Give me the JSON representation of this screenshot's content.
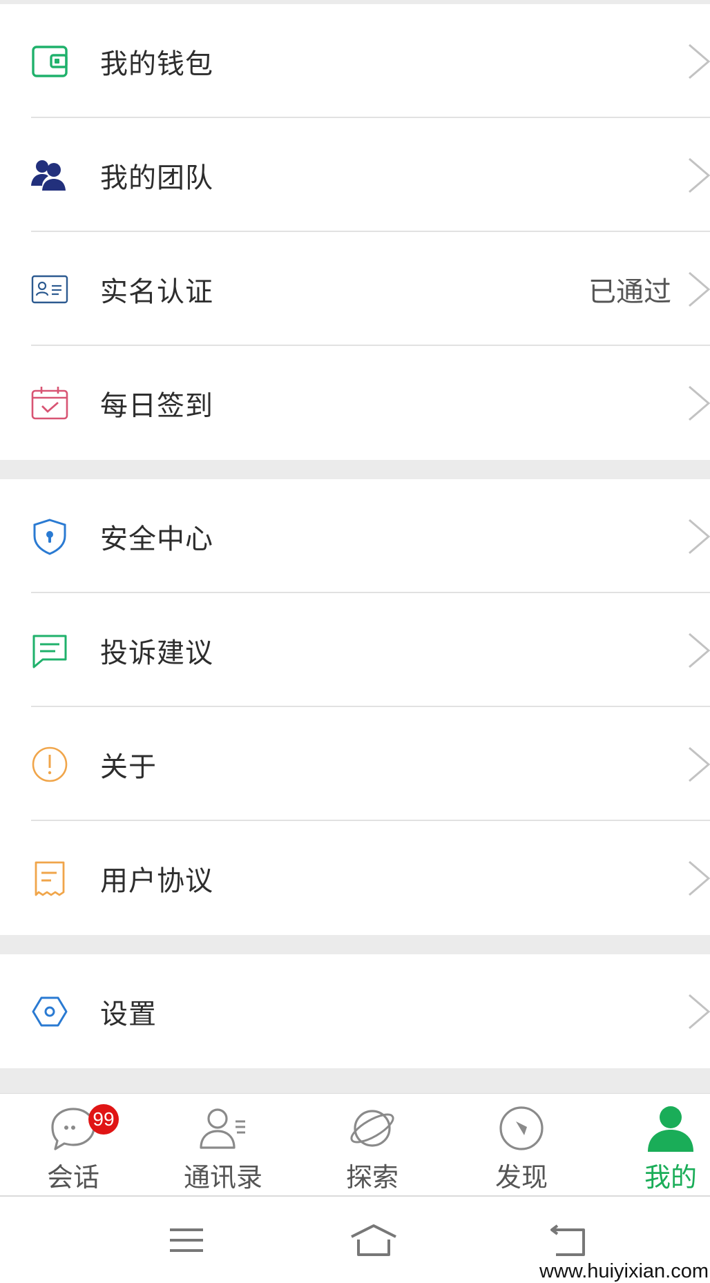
{
  "groups": [
    {
      "items": [
        {
          "id": "wallet",
          "label": "我的钱包",
          "value": "",
          "icon": "wallet-icon",
          "color": "#1fb16b"
        },
        {
          "id": "team",
          "label": "我的团队",
          "value": "",
          "icon": "team-icon",
          "color": "#22307c"
        },
        {
          "id": "realname",
          "label": "实名认证",
          "value": "已通过",
          "icon": "id-card-icon",
          "color": "#2c5a90"
        },
        {
          "id": "checkin",
          "label": "每日签到",
          "value": "",
          "icon": "calendar-check-icon",
          "color": "#d85473"
        }
      ]
    },
    {
      "items": [
        {
          "id": "security",
          "label": "安全中心",
          "value": "",
          "icon": "shield-icon",
          "color": "#2a7ad2"
        },
        {
          "id": "feedback",
          "label": "投诉建议",
          "value": "",
          "icon": "message-icon",
          "color": "#1fb16b"
        },
        {
          "id": "about",
          "label": "关于",
          "value": "",
          "icon": "info-icon",
          "color": "#f0a54a"
        },
        {
          "id": "agreement",
          "label": "用户协议",
          "value": "",
          "icon": "document-icon",
          "color": "#f0a54a"
        }
      ]
    },
    {
      "items": [
        {
          "id": "settings",
          "label": "设置",
          "value": "",
          "icon": "settings-icon",
          "color": "#2a7ad2"
        }
      ]
    }
  ],
  "tabs": [
    {
      "label": "会话",
      "icon": "chat-icon",
      "badge": "99"
    },
    {
      "label": "通讯录",
      "icon": "contacts-icon"
    },
    {
      "label": "探索",
      "icon": "planet-icon"
    },
    {
      "label": "发现",
      "icon": "compass-icon"
    },
    {
      "label": "我的",
      "icon": "person-icon",
      "active": true
    }
  ],
  "system_nav": [
    "menu-icon",
    "home-icon",
    "back-icon"
  ],
  "watermark": "www.huiyixian.com",
  "colors": {
    "accent": "#1aad58",
    "badge": "#e01515",
    "background": "#ebebeb"
  }
}
